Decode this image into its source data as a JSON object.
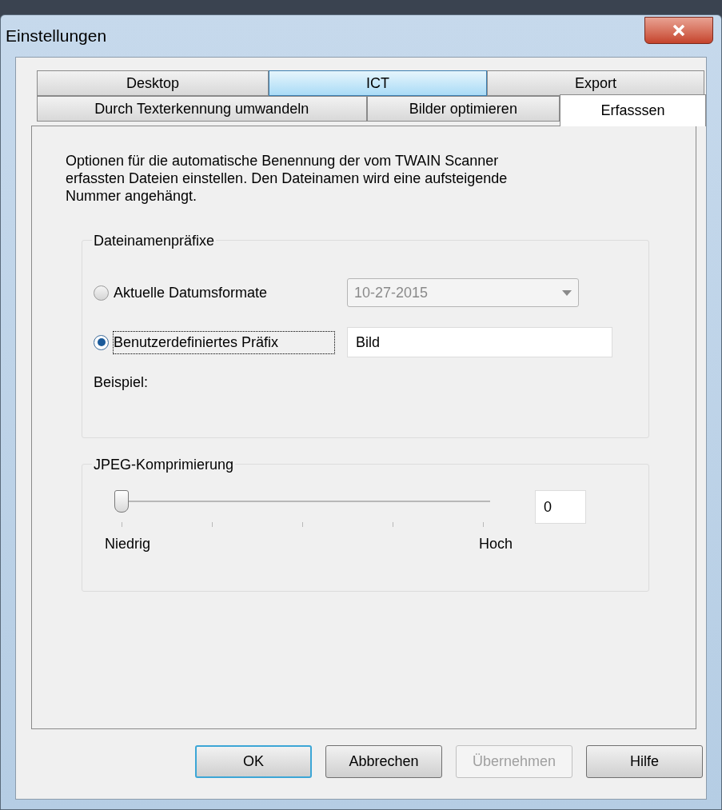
{
  "window": {
    "title": "Einstellungen"
  },
  "tab_rows": [
    [
      {
        "label": "Desktop",
        "selected": false,
        "hovered": false
      },
      {
        "label": "ICT",
        "selected": false,
        "hovered": true
      },
      {
        "label": "Export",
        "selected": false,
        "hovered": false
      }
    ],
    [
      {
        "label": "Durch Texterkennung umwandeln",
        "selected": false,
        "hovered": false
      },
      {
        "label": "Bilder optimieren",
        "selected": false,
        "hovered": false
      },
      {
        "label": "Erfasssen",
        "selected": true,
        "hovered": false
      }
    ]
  ],
  "description": "Optionen für die automatische Benennung der vom TWAIN Scanner erfassten Dateien einstellen. Den Dateinamen wird eine aufsteigende Nummer angehängt.",
  "prefix_group": {
    "title": "Dateinamenpräfixe",
    "options": [
      {
        "label": "Aktuelle Datumsformate",
        "selected": false,
        "kind": "dropdown",
        "value": "10-27-2015",
        "disabled": true
      },
      {
        "label": "Benutzerdefiniertes Präfix",
        "selected": true,
        "kind": "text",
        "value": "Bild",
        "disabled": false
      }
    ],
    "example_label": "Beispiel:"
  },
  "jpeg_group": {
    "title": "JPEG-Komprimierung",
    "level": 0,
    "value": "0",
    "min_label": "Niedrig",
    "max_label": "Hoch"
  },
  "buttons": [
    {
      "label": "OK",
      "default": true,
      "disabled": false
    },
    {
      "label": "Abbrechen",
      "default": false,
      "disabled": false
    },
    {
      "label": "Übernehmen",
      "default": false,
      "disabled": true
    },
    {
      "label": "Hilfe",
      "default": false,
      "disabled": false
    }
  ]
}
